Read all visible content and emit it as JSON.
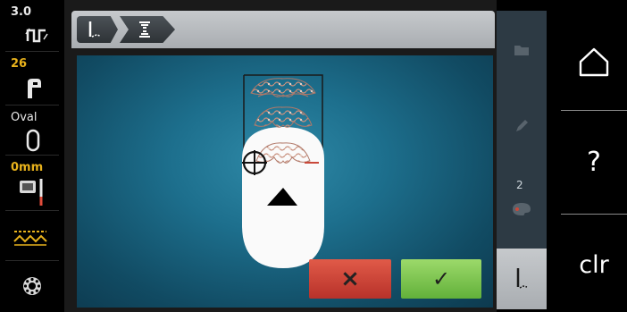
{
  "left_bar": {
    "stitch_width": {
      "value": "3.0",
      "icon": "stitch-width-icon"
    },
    "presser_foot": {
      "value": "26",
      "icon": "presser-foot-icon"
    },
    "hoop": {
      "value": "Oval",
      "icon": "oval-hoop-icon"
    },
    "needle_position": {
      "value": "0mm",
      "icon": "needle-plate-icon"
    },
    "feed_dog": {
      "icon": "feed-dog-icon"
    },
    "bobbin": {
      "icon": "bobbin-icon"
    }
  },
  "header": {
    "crumbs": [
      {
        "icon": "needle-mode-icon"
      },
      {
        "icon": "stitch-pattern-icon"
      }
    ]
  },
  "side_tools": {
    "folder": {
      "icon": "folder-icon"
    },
    "edit": {
      "icon": "pencil-icon"
    },
    "color": {
      "count": "2",
      "icon": "color-palette-icon"
    },
    "needle": {
      "icon": "needle-icon"
    }
  },
  "right_bar": {
    "home": {
      "icon": "home-icon"
    },
    "help": {
      "label": "?"
    },
    "clear": {
      "label": "clr"
    }
  },
  "actions": {
    "cancel": {
      "symbol": "×"
    },
    "confirm": {
      "symbol": "✓"
    }
  },
  "colors": {
    "accent_yellow": "#e8b21c",
    "cancel_red": "#c63a2e",
    "confirm_green": "#78c24a",
    "stage_teal": "#1d6f8d"
  }
}
